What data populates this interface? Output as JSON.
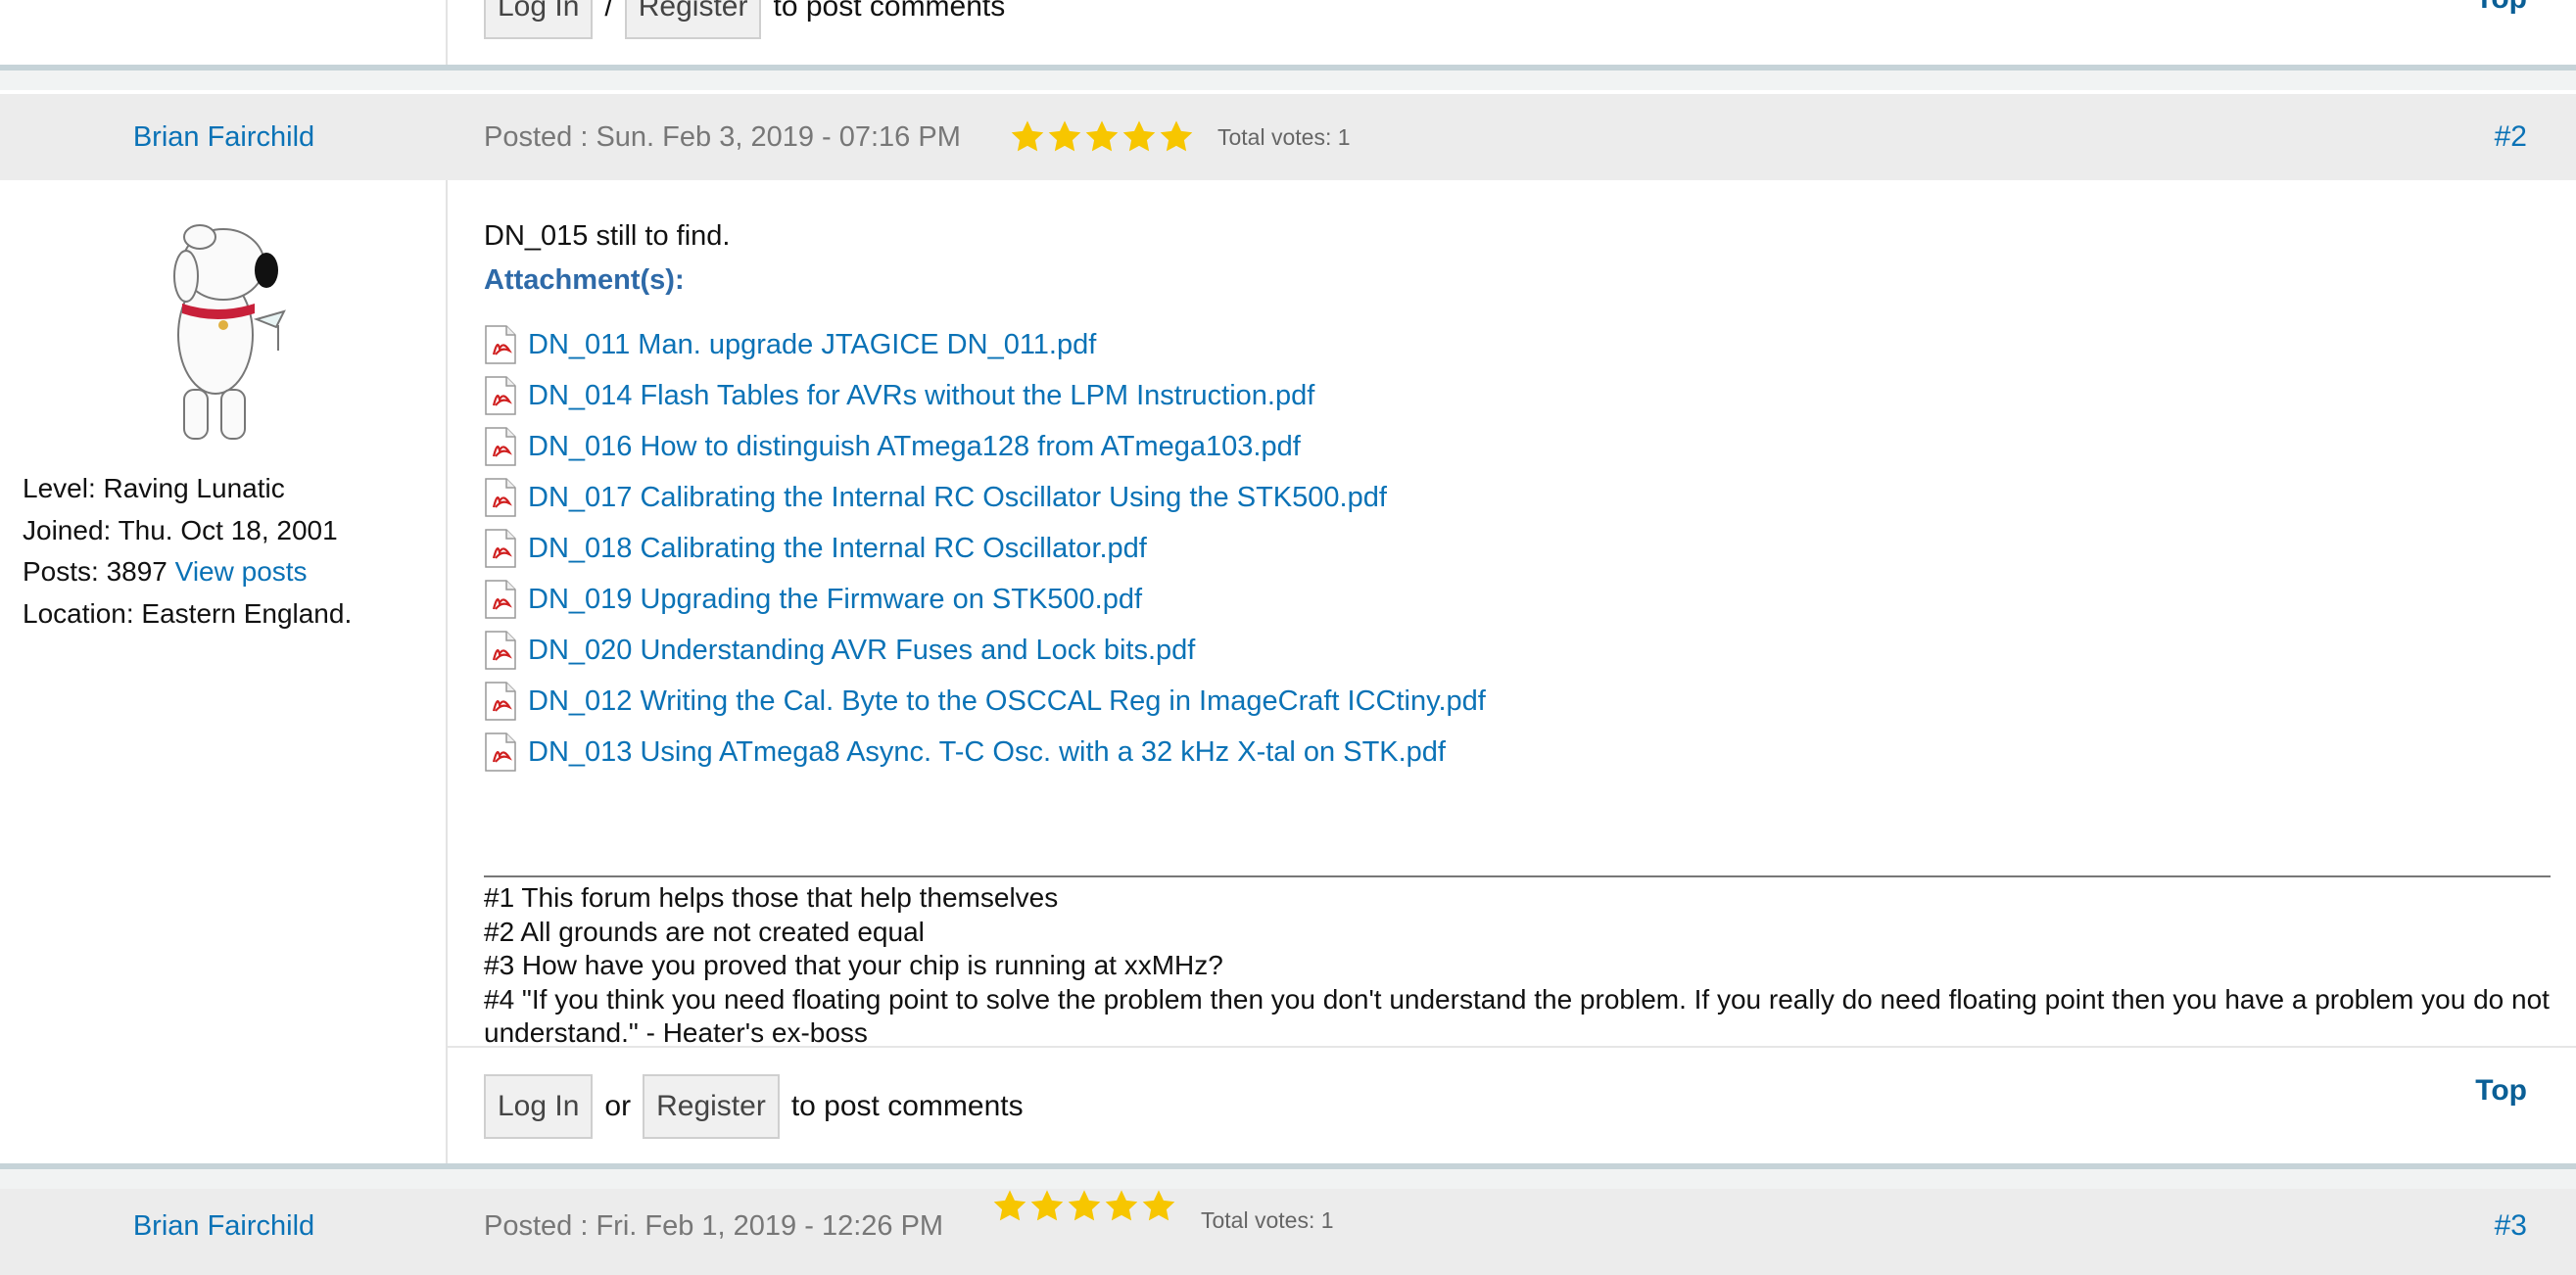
{
  "prev_post_footer": {
    "login_label": "Log In",
    "separator": "/",
    "register_label": "Register",
    "tail": "to post comments",
    "top_label": "Top"
  },
  "post": {
    "author": "Brian Fairchild",
    "posted": "Posted : Sun. Feb 3, 2019 - 07:16 PM",
    "stars": 5,
    "votes": "Total votes: 1",
    "number": "#2",
    "profile": {
      "level": "Level: Raving Lunatic",
      "joined": "Joined: Thu. Oct 18, 2001",
      "posts_prefix": "Posts: 3897",
      "view_posts": "View posts",
      "location": "Location: Eastern England."
    },
    "body_text": "DN_015 still to find.",
    "attachments_label": "Attachment(s):",
    "attachments": [
      "DN_011 Man. upgrade JTAGICE DN_011.pdf",
      "DN_014 Flash Tables for AVRs without the LPM Instruction.pdf",
      "DN_016 How to distinguish ATmega128 from ATmega103.pdf",
      "DN_017 Calibrating the Internal RC Oscillator Using the STK500.pdf",
      "DN_018 Calibrating the Internal RC Oscillator.pdf",
      "DN_019 Upgrading the Firmware on STK500.pdf",
      "DN_020 Understanding AVR Fuses and Lock bits.pdf",
      "DN_012 Writing the Cal. Byte to the OSCCAL Reg in ImageCraft ICCtiny.pdf",
      "DN_013 Using ATmega8 Async. T-C Osc. with a 32 kHz X-tal on STK.pdf"
    ],
    "signature": [
      "#1 This forum helps those that help themselves",
      "#2 All grounds are not created equal",
      "#3 How have you proved that your chip is running at xxMHz?",
      "#4 \"If you think you need floating point to solve the problem then you don't understand the problem. If you really do need floating point then you have a problem you do not understand.\" - Heater's ex-boss"
    ],
    "footer": {
      "login_label": "Log In",
      "separator": "or",
      "register_label": "Register",
      "tail": "to post comments",
      "top_label": "Top"
    }
  },
  "next_post": {
    "author": "Brian Fairchild",
    "posted": "Posted : Fri. Feb 1, 2019 - 12:26 PM",
    "stars": 5,
    "votes": "Total votes: 1",
    "number": "#3"
  },
  "colors": {
    "link": "#0a72b6",
    "star": "#f7c600",
    "header_bg": "#ececec",
    "attach_label": "#2e6aa8"
  }
}
